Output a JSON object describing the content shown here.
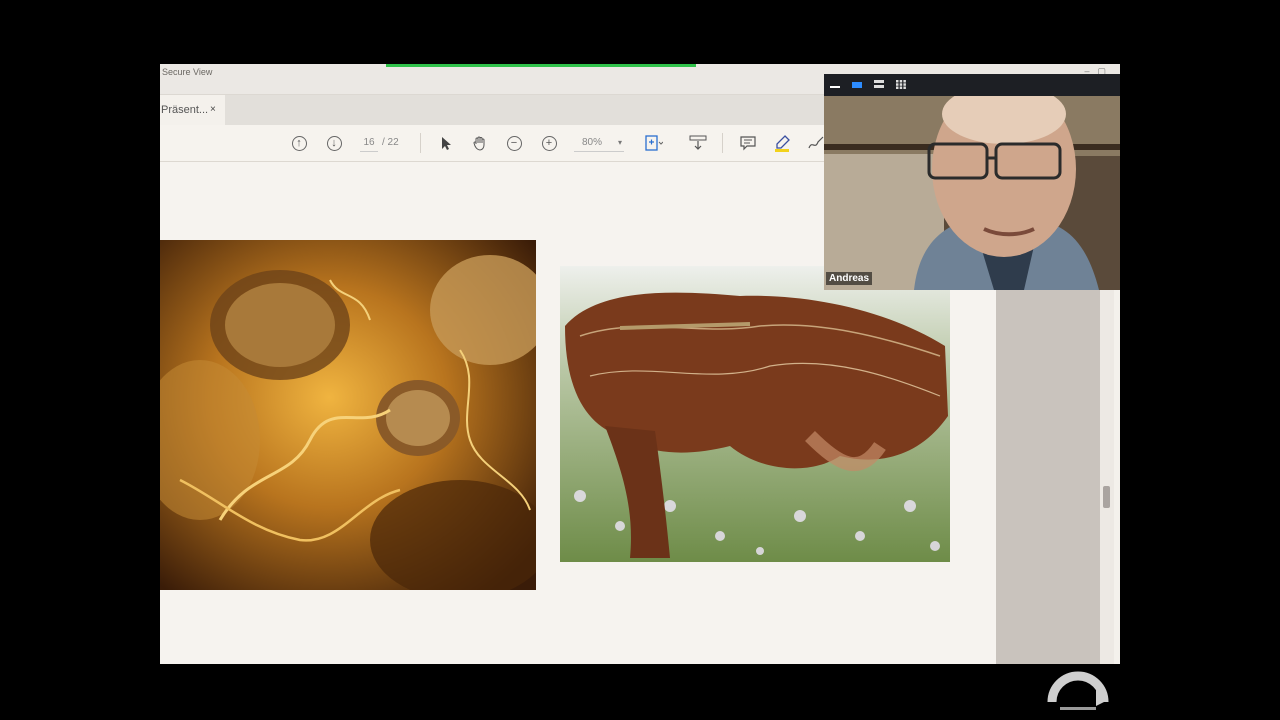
{
  "window": {
    "title": "Secure View"
  },
  "tabs": [
    {
      "label": "Präsent...",
      "close": "×"
    }
  ],
  "toolbar": {
    "current_page": "16",
    "page_separator": "/ 22",
    "zoom": "80%",
    "tools": [
      "page-up-icon",
      "page-down-icon",
      "select-cursor-icon",
      "hand-icon",
      "zoom-out-icon",
      "zoom-in-icon",
      "fit-page-icon",
      "scroll-mode-icon",
      "comment-icon",
      "highlight-icon",
      "sign-icon"
    ]
  },
  "video_call": {
    "participant_name": "Andreas",
    "view_controls": [
      "minimize-icon",
      "speaker-view-icon",
      "strip-view-icon",
      "gallery-view-icon"
    ]
  },
  "colors": {
    "accent": "#2fc24a",
    "video_bar": "#1d1f24",
    "soil": "#7a3a1c"
  }
}
